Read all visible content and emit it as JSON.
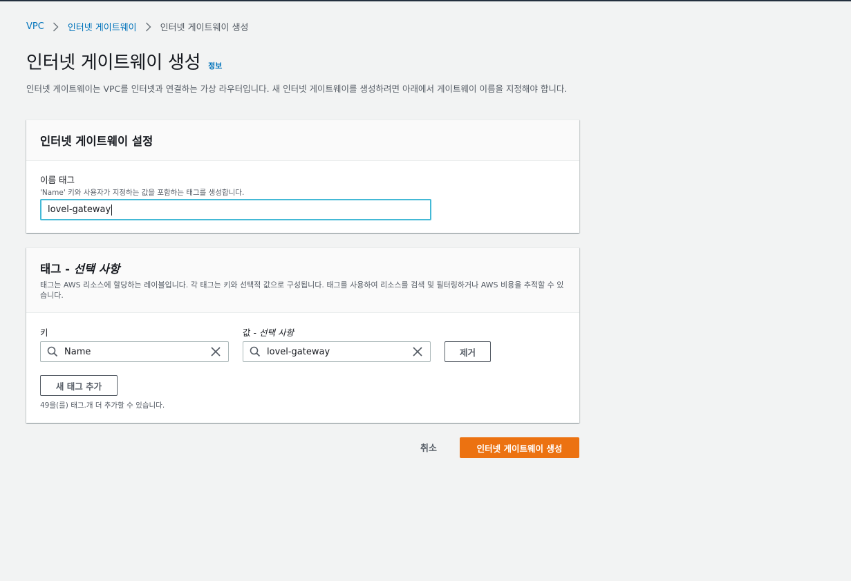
{
  "breadcrumb": [
    {
      "label": "VPC",
      "link": true
    },
    {
      "label": "인터넷 게이트웨이",
      "link": true
    },
    {
      "label": "인터넷 게이트웨이 생성",
      "link": false
    }
  ],
  "page": {
    "title": "인터넷 게이트웨이 생성",
    "info_link": "정보",
    "description": "인터넷 게이트웨이는 VPC를 인터넷과 연결하는 가상 라우터입니다. 새 인터넷 게이트웨이를 생성하려면 아래에서 게이트웨이 이름을 지정해야 합니다."
  },
  "settings_panel": {
    "title": "인터넷 게이트웨이 설정",
    "name_tag_label": "이름 태그",
    "name_tag_description": "'Name' 키와 사용자가 지정하는 값을 포함하는 태그를 생성합니다.",
    "name_tag_value": "lovel-gateway"
  },
  "tags_panel": {
    "title_main": "태그 - ",
    "title_optional": "선택 사항",
    "description": "태그는 AWS 리소스에 할당하는 레이블입니다. 각 태그는 키와 선택적 값으로 구성됩니다. 태그를 사용하여 리소스를 검색 및 필터링하거나 AWS 비용을 추적할 수 있습니다.",
    "key_label": "키",
    "value_label_main": "값 - ",
    "value_label_optional": "선택 사항",
    "tags": [
      {
        "key": "Name",
        "value": "lovel-gateway"
      }
    ],
    "remove_label": "제거",
    "add_tag_label": "새 태그 추가",
    "limit_note": "49을(를) 태그.개 더 추가할 수 있습니다."
  },
  "footer": {
    "cancel_label": "취소",
    "create_label": "인터넷 게이트웨이 생성"
  },
  "colors": {
    "primary": "#ec7211",
    "link": "#0073bb",
    "focus": "#44b9d6"
  },
  "icons": {
    "breadcrumb_separator": "chevron-right-icon",
    "search": "search-icon",
    "clear": "close-icon"
  }
}
